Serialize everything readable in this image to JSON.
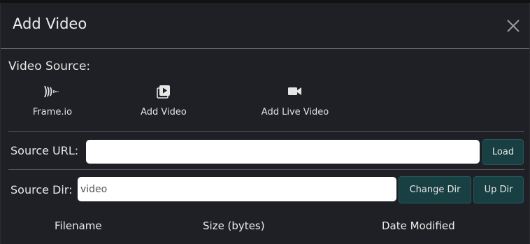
{
  "dialog": {
    "title": "Add Video",
    "close_icon": "close-icon"
  },
  "video_source": {
    "label": "Video Source:",
    "options": [
      {
        "label": "Frame.io",
        "icon": "frameio-icon"
      },
      {
        "label": "Add Video",
        "icon": "video-play-icon"
      },
      {
        "label": "Add Live Video",
        "icon": "video-camera-icon"
      }
    ]
  },
  "source_url": {
    "label": "Source URL:",
    "value": "",
    "load_label": "Load"
  },
  "source_dir": {
    "label": "Source Dir:",
    "value": "video",
    "change_dir_label": "Change Dir",
    "up_dir_label": "Up Dir"
  },
  "file_table": {
    "columns": [
      "Filename",
      "Size (bytes)",
      "Date Modified"
    ]
  },
  "colors": {
    "background": "#1f2025",
    "button": "#183f42",
    "text": "#e8e8e8"
  }
}
